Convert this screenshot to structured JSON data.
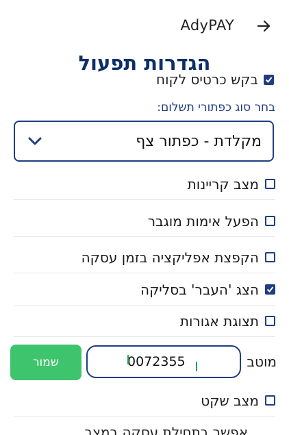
{
  "header": {
    "app_name": "AdyPAY",
    "page_title": "הגדרות תפעול"
  },
  "clipped_top_row": {
    "label": "בקש כרטיס לקוח",
    "checked": true
  },
  "payment_buttons": {
    "section_label": "בחר סוג כפתורי תשלום:",
    "selected_value": "מקלדת - כפתור צף"
  },
  "options": [
    {
      "label": "מצב קריינות",
      "checked": false
    },
    {
      "label": "הפעל אימות מוגבר",
      "checked": false
    },
    {
      "label": "הקפצת אפליקציה בזמן עסקה",
      "checked": false
    },
    {
      "label": "הצג 'העבר' בסליקה",
      "checked": true
    },
    {
      "label": "תצוגת אגורות",
      "checked": false
    }
  ],
  "terminal": {
    "label": "מוטב",
    "value": "0072355",
    "save_label": "שמור"
  },
  "quiet_mode": {
    "label": "מצב שקט",
    "checked": false
  },
  "bottom_clipped_text": "אפשר בתחילת עסקה במצב",
  "colors": {
    "primary": "#1f3d80",
    "title": "#0d2f66",
    "save_button": "#3ec46d"
  }
}
